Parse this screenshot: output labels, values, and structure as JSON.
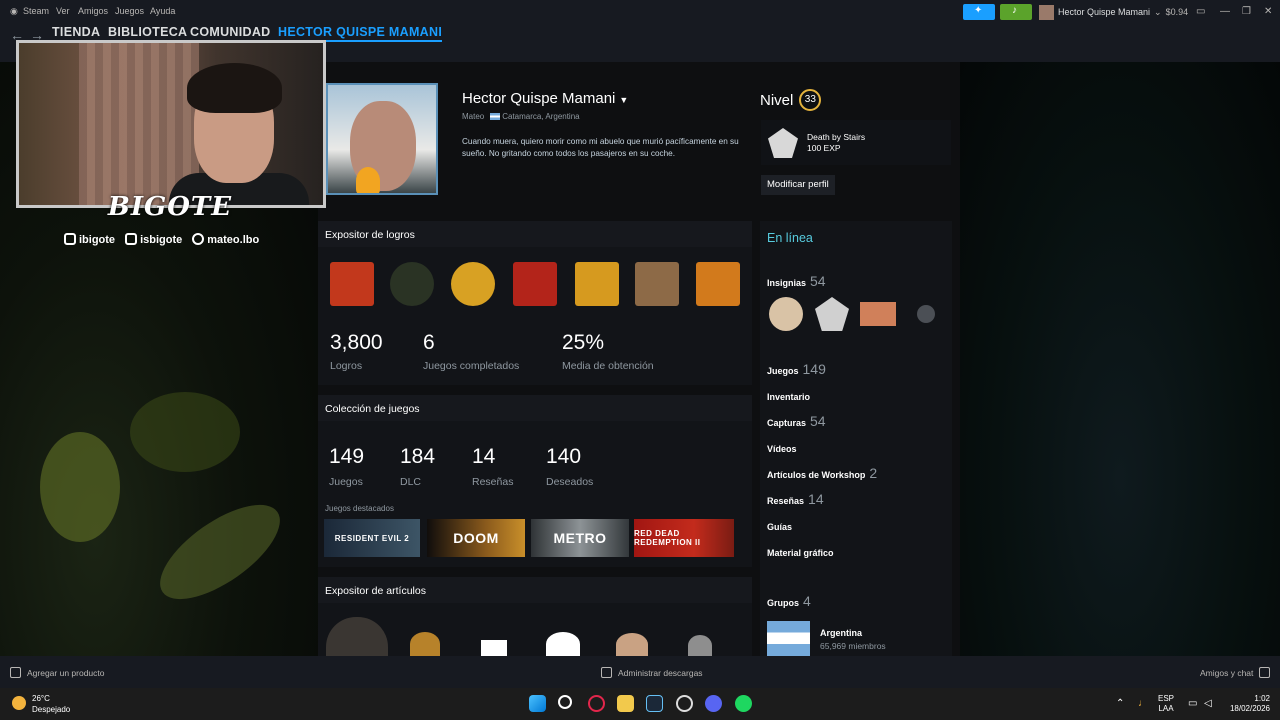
{
  "menu": {
    "steam": "Steam",
    "ver": "Ver",
    "amigos": "Amigos",
    "juegos": "Juegos",
    "ayuda": "Ayuda"
  },
  "account": {
    "name": "Hector Quispe Mamani",
    "balance": "$0.94"
  },
  "nav": {
    "tabs": [
      "TIENDA",
      "BIBLIOTECA",
      "COMUNIDAD",
      "HECTOR QUISPE MAMANI"
    ]
  },
  "stream_overlay": {
    "label": "BIGOTE",
    "twitch_kick": "ibigote",
    "tiktok": "isbigote",
    "instagram": "mateo.lbo"
  },
  "profile": {
    "name": "Hector Quispe Mamani",
    "real_name": "Mateo",
    "location": "Catamarca, Argentina",
    "summary": "Cuando muera, quiero morir como mi abuelo que murió pacíficamente en su sueño. No gritando como todos los pasajeros en su coche.",
    "level_label": "Nivel",
    "level": "33",
    "favorite_badge": {
      "name": "Death by Stairs",
      "xp": "100 EXP"
    },
    "edit_label": "Modificar perfil"
  },
  "achievement_showcase": {
    "title": "Expositor de logros",
    "icon_colors": [
      "#c2381c",
      "#2a3324",
      "#d8a123",
      "#b3241a",
      "#d69a1f",
      "#8d6a47",
      "#d27a1c"
    ],
    "stats": [
      {
        "value": "3,800",
        "label": "Logros"
      },
      {
        "value": "6",
        "label": "Juegos completados"
      },
      {
        "value": "25%",
        "label": "Media de obtención"
      }
    ]
  },
  "game_collection": {
    "title": "Colección de juegos",
    "stats": [
      {
        "value": "149",
        "label": "Juegos"
      },
      {
        "value": "184",
        "label": "DLC"
      },
      {
        "value": "14",
        "label": "Reseñas"
      },
      {
        "value": "140",
        "label": "Deseados"
      }
    ],
    "featured_label": "Juegos destacados",
    "featured": [
      "RESIDENT EVIL 2",
      "DOOM",
      "METRO",
      "RED DEAD REDEMPTION II"
    ]
  },
  "item_showcase": {
    "title": "Expositor de artículos"
  },
  "sidebar": {
    "status": "En línea",
    "badges": {
      "label": "Insignias",
      "count": "54"
    },
    "games": {
      "label": "Juegos",
      "count": "149"
    },
    "inventory": "Inventario",
    "screenshots": {
      "label": "Capturas",
      "count": "54"
    },
    "videos": "Vídeos",
    "workshop": {
      "label": "Artículos de Workshop",
      "count": "2"
    },
    "reviews": {
      "label": "Reseñas",
      "count": "14"
    },
    "guides": "Guías",
    "artwork": "Material gráfico",
    "groups": {
      "label": "Grupos",
      "count": "4"
    },
    "group": {
      "name": "Argentina",
      "members": "65,969 miembros"
    }
  },
  "bottom_bar": {
    "add_product": "Agregar un producto",
    "downloads": "Administrar descargas",
    "friends": "Amigos y chat"
  },
  "taskbar": {
    "weather_temp": "26°C",
    "weather_desc": "Despejado",
    "lang": "ESP",
    "layout": "LAA",
    "time": "1:02",
    "date": "18/02/2026"
  }
}
